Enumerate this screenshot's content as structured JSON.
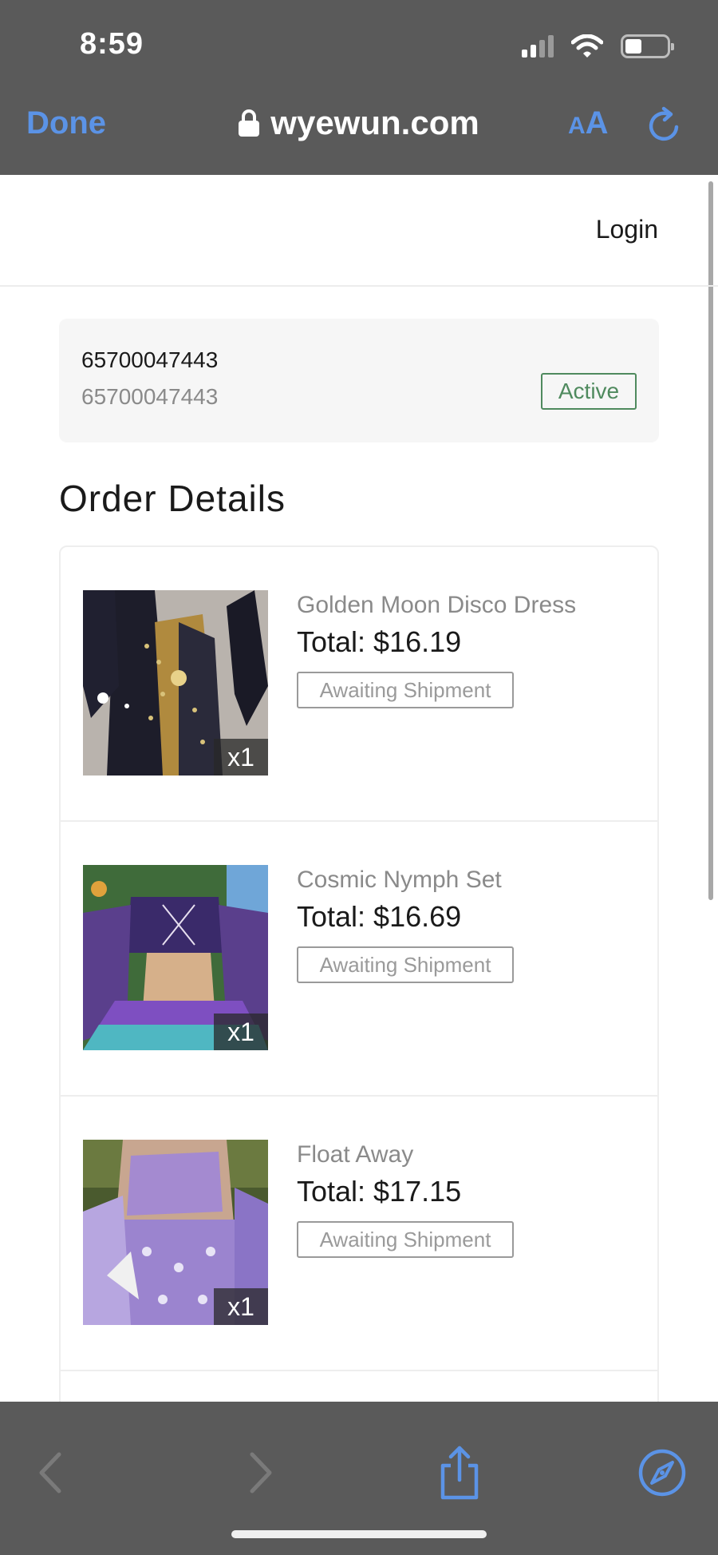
{
  "status": {
    "time": "8:59"
  },
  "browser": {
    "done_label": "Done",
    "url": "wyewun.com",
    "aa_label_small": "A",
    "aa_label_large": "A"
  },
  "header": {
    "login_label": "Login"
  },
  "order": {
    "id": "65700047443",
    "sub_id": "65700047443",
    "status": "Active"
  },
  "section_title": "Order Details",
  "items": [
    {
      "name": "Golden Moon Disco Dress",
      "total": "Total: $16.19",
      "status": "Awaiting Shipment",
      "qty": "x1"
    },
    {
      "name": "Cosmic Nymph Set",
      "total": "Total: $16.69",
      "status": "Awaiting Shipment",
      "qty": "x1"
    },
    {
      "name": "Float Away",
      "total": "Total: $17.15",
      "status": "Awaiting Shipment",
      "qty": "x1"
    }
  ],
  "colors": {
    "accent_blue": "#5b93e6",
    "active_green": "#4f8a5e",
    "chrome_gray": "#5a5a5a"
  },
  "icons": {
    "back": "chevron-left-icon",
    "forward": "chevron-right-icon",
    "share": "share-icon",
    "safari": "compass-icon",
    "reload": "reload-icon",
    "lock": "lock-icon",
    "wifi": "wifi-icon",
    "signal": "signal-icon",
    "battery": "battery-icon"
  }
}
